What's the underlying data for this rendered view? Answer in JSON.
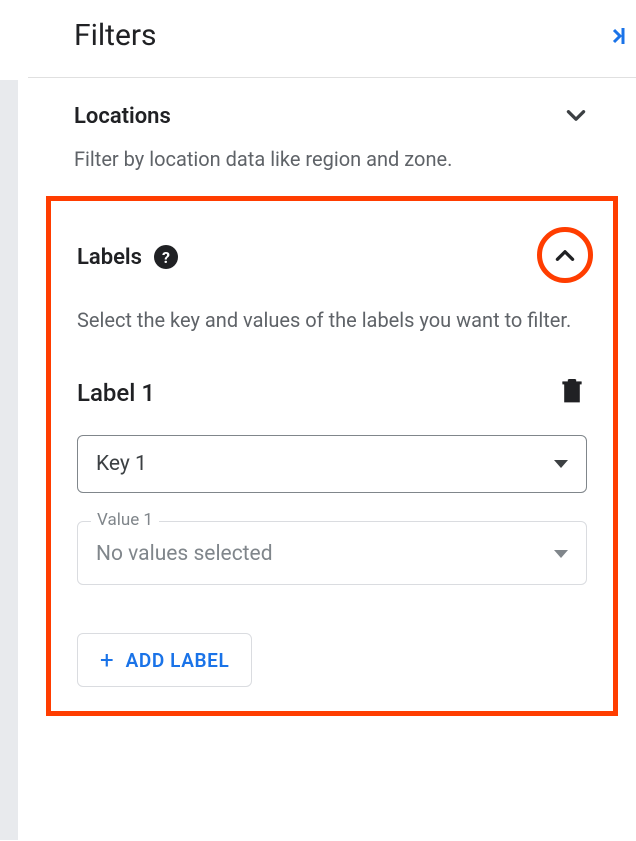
{
  "header": {
    "title": "Filters"
  },
  "sections": {
    "locations": {
      "title": "Locations",
      "description": "Filter by location data like region and zone."
    },
    "labels": {
      "title": "Labels",
      "description": "Select the key and values of the labels you want to filter.",
      "items": [
        {
          "title": "Label 1",
          "key_select": {
            "value": "Key 1"
          },
          "value_select": {
            "legend": "Value 1",
            "placeholder": "No values selected"
          }
        }
      ],
      "add_button": "ADD LABEL"
    }
  }
}
